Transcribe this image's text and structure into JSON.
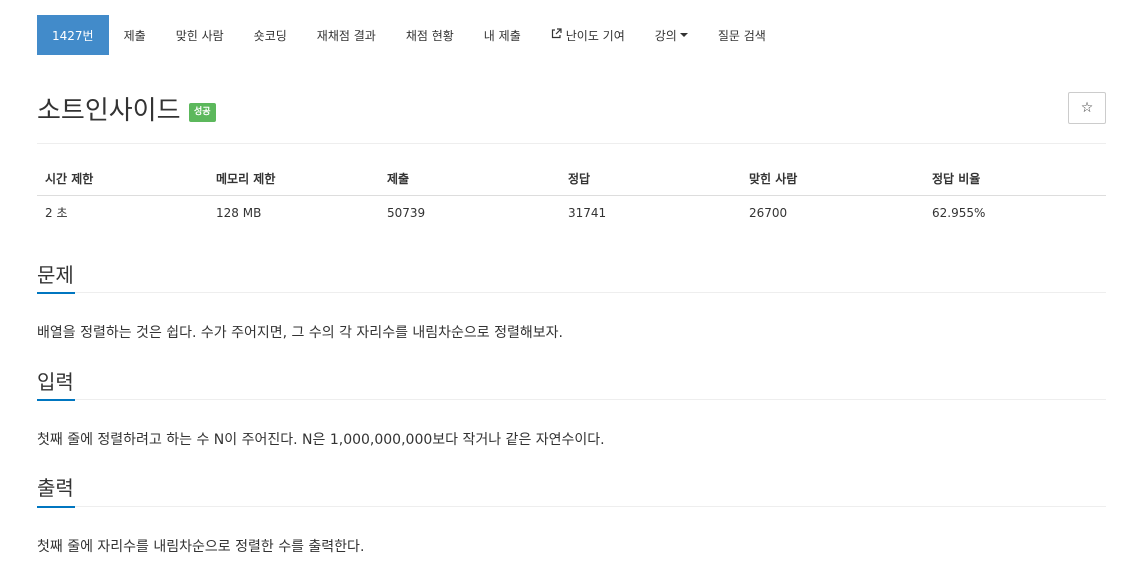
{
  "nav": {
    "items": [
      {
        "label": "1427번",
        "active": true
      },
      {
        "label": "제출"
      },
      {
        "label": "맞힌 사람"
      },
      {
        "label": "숏코딩"
      },
      {
        "label": "재채점 결과"
      },
      {
        "label": "채점 현황"
      },
      {
        "label": "내 제출"
      },
      {
        "label": "난이도 기여",
        "icon": "external-link-icon"
      },
      {
        "label": "강의",
        "icon": "caret-down-icon"
      },
      {
        "label": "질문 검색"
      }
    ]
  },
  "problem": {
    "title": "소트인사이드",
    "status_badge": "성공",
    "star_icon": "☆"
  },
  "info": {
    "headers": [
      "시간 제한",
      "메모리 제한",
      "제출",
      "정답",
      "맞힌 사람",
      "정답 비율"
    ],
    "values": [
      "2 초",
      "128 MB",
      "50739",
      "31741",
      "26700",
      "62.955%"
    ]
  },
  "sections": {
    "problem": {
      "title": "문제",
      "text": "배열을 정렬하는 것은 쉽다. 수가 주어지면, 그 수의 각 자리수를 내림차순으로 정렬해보자."
    },
    "input": {
      "title": "입력",
      "text": "첫째 줄에 정렬하려고 하는 수 N이 주어진다. N은 1,000,000,000보다 작거나 같은 자연수이다."
    },
    "output": {
      "title": "출력",
      "text": "첫째 줄에 자리수를 내림차순으로 정렬한 수를 출력한다."
    }
  },
  "colors": {
    "accent": "#428bca",
    "success": "#5cb85c",
    "section_underline": "#0076c0"
  }
}
